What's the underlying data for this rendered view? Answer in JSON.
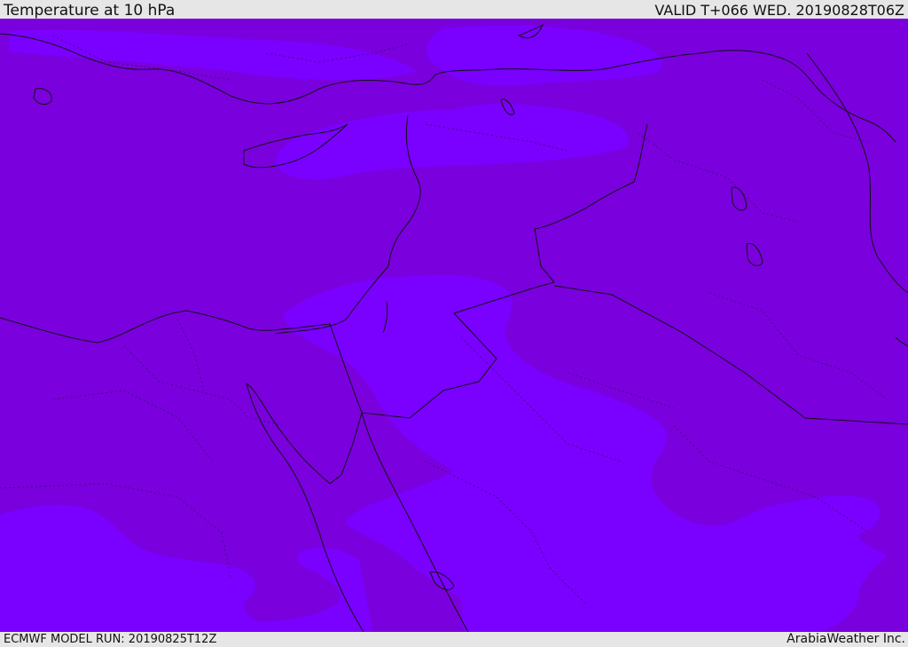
{
  "header": {
    "title": "Temperature at 10 hPa",
    "valid": "VALID T+066 WED. 20190828T06Z"
  },
  "footer": {
    "model_run": "ECMWF MODEL RUN: 20190825T12Z",
    "credit": "ArabiaWeather Inc."
  },
  "map": {
    "colors": {
      "warm_band": "#7a00de",
      "cool_band": "#7a00ff",
      "boundary": "#111111"
    }
  }
}
